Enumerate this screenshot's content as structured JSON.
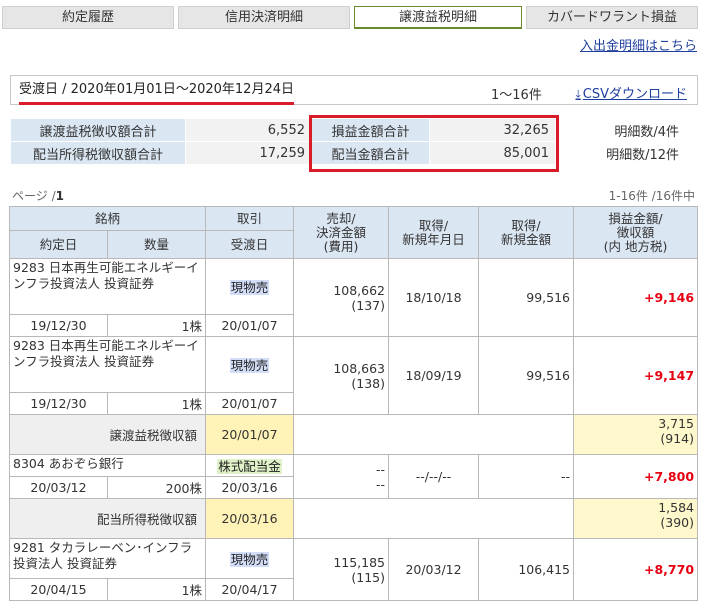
{
  "tabs": [
    {
      "label": "約定履歴",
      "active": false
    },
    {
      "label": "信用決済明細",
      "active": false
    },
    {
      "label": "譲渡益税明細",
      "active": true
    },
    {
      "label": "カバードワラント損益",
      "active": false
    }
  ],
  "nyushutsu_link": "入出金明細はこちら",
  "filter": {
    "text": "受渡日 / 2020年01月01日～2020年12月24日",
    "count": "1～16件",
    "csv_label": "CSVダウンロード"
  },
  "summary": {
    "row1": {
      "label1": "譲渡益税徴収額合計",
      "value1": "6,552",
      "label2": "損益金額合計",
      "value2": "32,265",
      "count": "明細数/4件"
    },
    "row2": {
      "label1": "配当所得税徴収額合計",
      "value1": "17,259",
      "label2": "配当金額合計",
      "value2": "85,001",
      "count": "明細数/12件"
    }
  },
  "pager": {
    "label": "ページ /",
    "page": "1",
    "range": "1-16件 /16件中"
  },
  "headers": {
    "meigara": "銘柄",
    "torihiki": "取引",
    "baikyaku": [
      "売却/",
      "決済金額",
      "(費用)"
    ],
    "shutoku_date": [
      "取得/",
      "新規年月日"
    ],
    "shutoku_amount": [
      "取得/",
      "新規金額"
    ],
    "soneki": [
      "損益金額/",
      "徴収額",
      "(内 地方税)"
    ],
    "yakujo": "約定日",
    "suryo": "数量",
    "ukewatashi": "受渡日"
  },
  "rows": [
    {
      "name": "9283 日本再生可能エネルギーインフラ投資法人 投資証券",
      "type": "現物売",
      "sell": "108,662",
      "fee": "(137)",
      "acq_date": "18/10/18",
      "acq_amount": "99,516",
      "pl": "+9,146",
      "trade_date": "19/12/30",
      "qty": "1株",
      "settle_date": "20/01/07"
    },
    {
      "name": "9283 日本再生可能エネルギーインフラ投資法人 投資証券",
      "type": "現物売",
      "sell": "108,663",
      "fee": "(138)",
      "acq_date": "18/09/19",
      "acq_amount": "99,516",
      "pl": "+9,147",
      "trade_date": "19/12/30",
      "qty": "1株",
      "settle_date": "20/01/07"
    },
    {
      "tax_label": "譲渡益税徴収額",
      "date": "20/01/07",
      "amount": "3,715",
      "local": "(914)"
    },
    {
      "name": "8304 あおぞら銀行",
      "type": "株式配当金",
      "sell": "--",
      "fee": "--",
      "acq_date": "--/--/--",
      "acq_amount": "--",
      "pl": "+7,800",
      "trade_date": "20/03/12",
      "qty": "200株",
      "settle_date": "20/03/16"
    },
    {
      "tax_label": "配当所得税徴収額",
      "date": "20/03/16",
      "amount": "1,584",
      "local": "(390)"
    },
    {
      "name": "9281 タカラレーベン･インフラ投資法人 投資証券",
      "type": "現物売",
      "sell": "115,185",
      "fee": "(115)",
      "acq_date": "20/03/12",
      "acq_amount": "106,415",
      "pl": "+8,770",
      "trade_date": "20/04/15",
      "qty": "1株",
      "settle_date": "20/04/17"
    }
  ]
}
